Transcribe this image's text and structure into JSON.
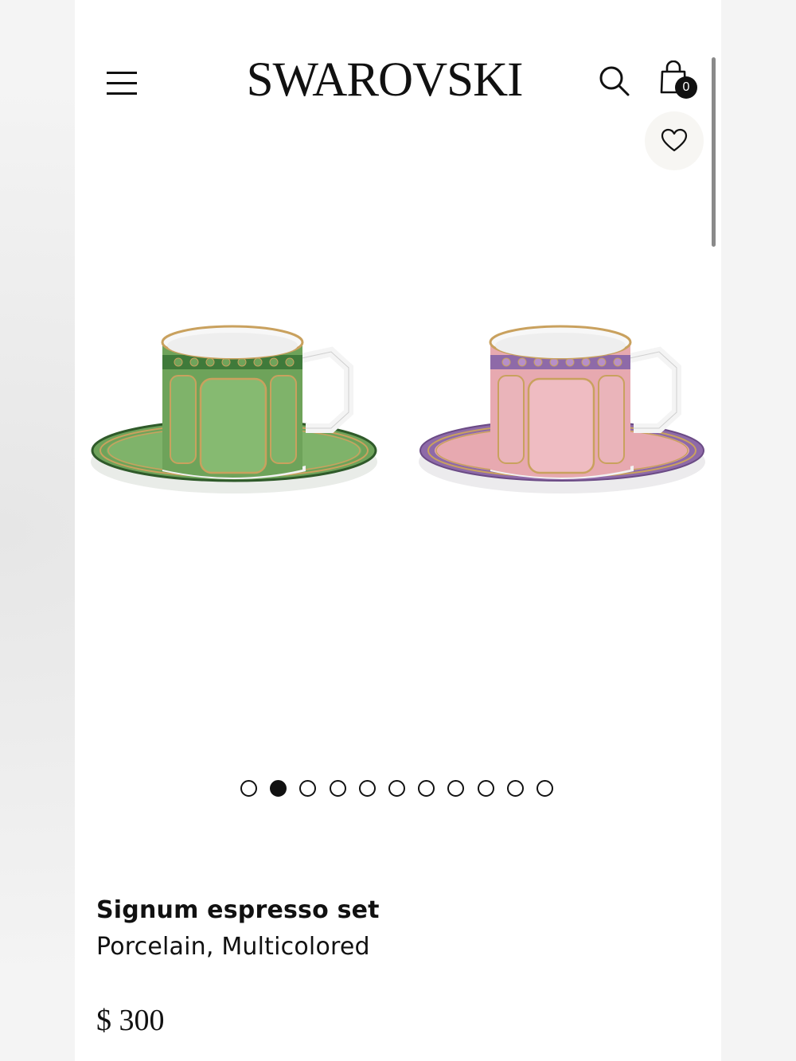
{
  "header": {
    "brand": "SWAROVSKI",
    "menu_icon": "hamburger-menu-icon",
    "search_icon": "search-icon",
    "bag_icon": "shopping-bag-icon",
    "bag_count": "0",
    "wishlist_icon": "heart-icon"
  },
  "gallery": {
    "total_images": 11,
    "active_index": 1
  },
  "product": {
    "name": "Signum espresso set",
    "material": "Porcelain, Multicolored",
    "price": "$ 300"
  },
  "colors": {
    "green_cup": "#6ea35a",
    "pink_cup": "#e7a9b0",
    "purple_band": "#8e6aa8",
    "gold_trim": "#c9a15e"
  }
}
